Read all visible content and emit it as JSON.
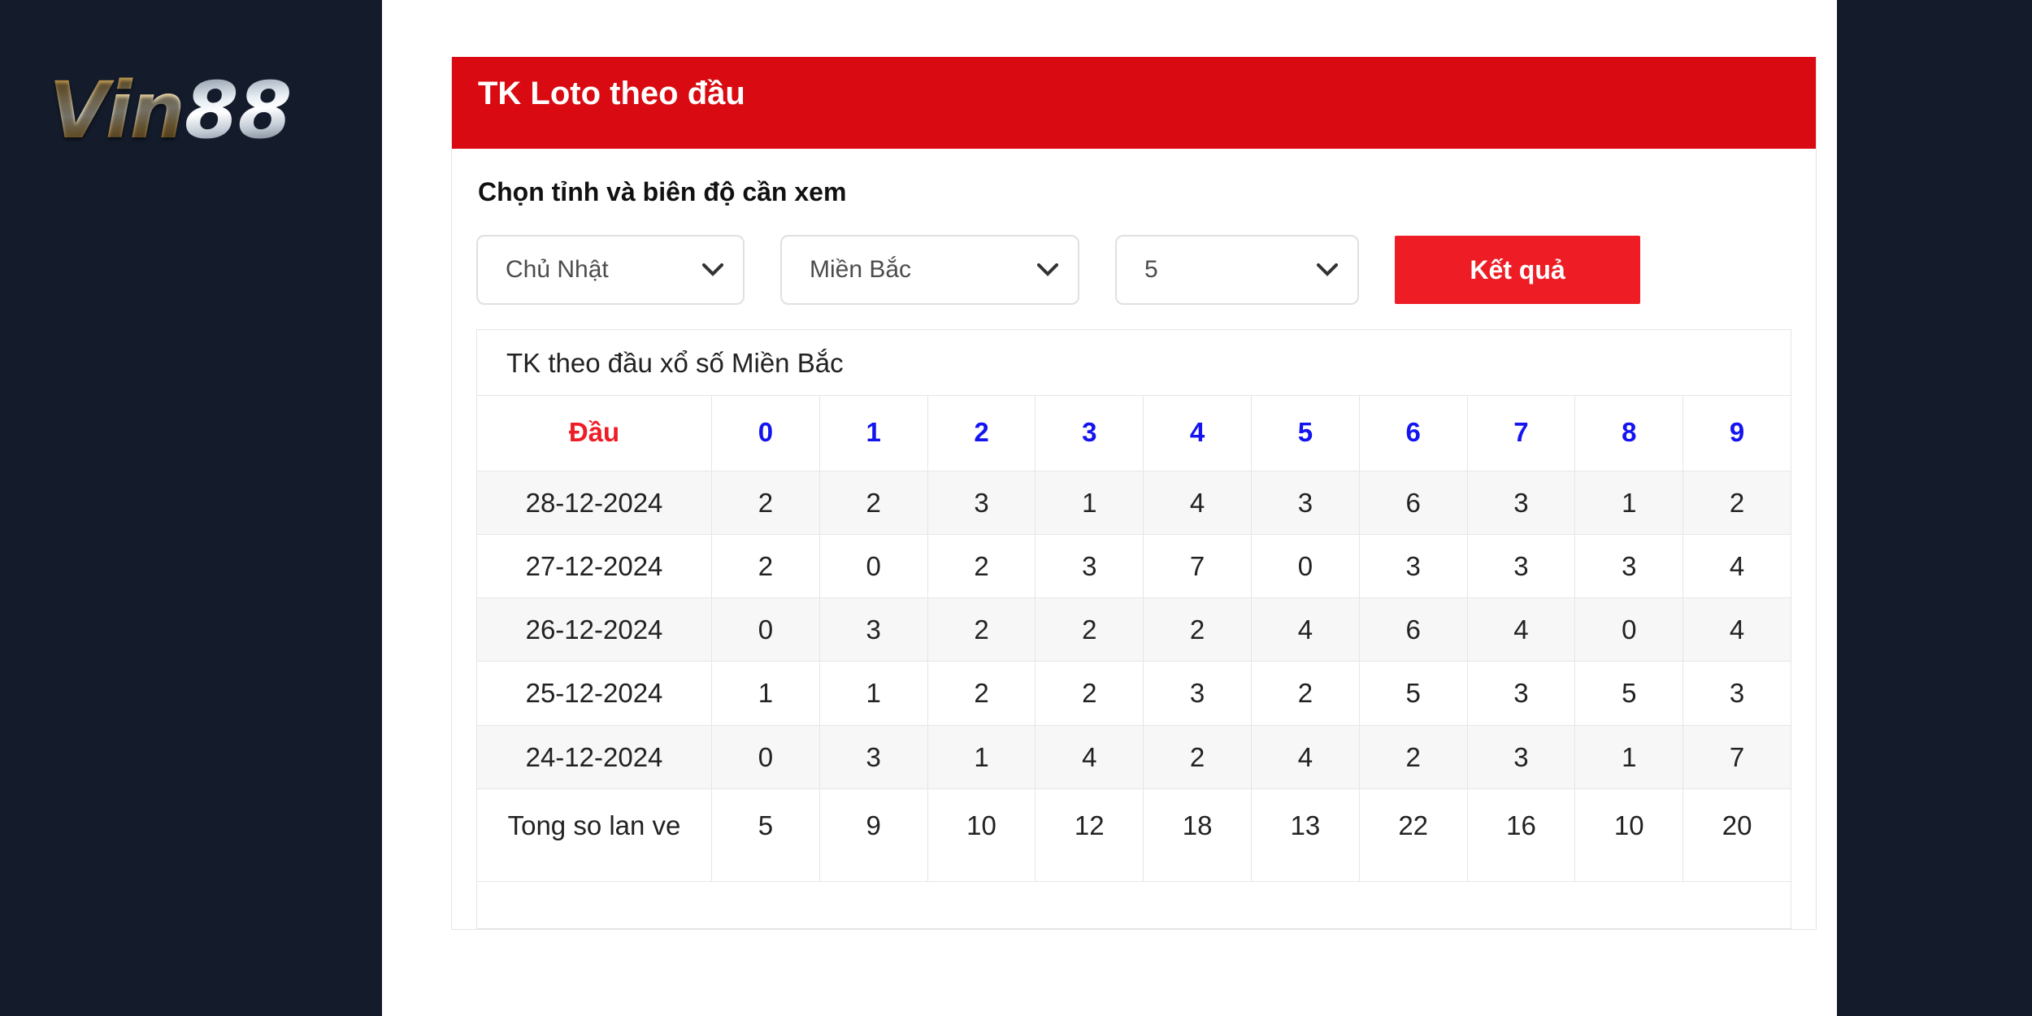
{
  "brand": {
    "name_part1": "Vin",
    "name_part2": "88"
  },
  "panel": {
    "title": "TK Loto theo đầu",
    "form_label": "Chọn tỉnh và biên độ cần xem"
  },
  "controls": {
    "day_select": {
      "value": "Chủ Nhật"
    },
    "region_select": {
      "value": "Miền Bắc"
    },
    "range_select": {
      "value": "5"
    },
    "submit_button": "Kết quả"
  },
  "table": {
    "caption": "TK theo đầu xổ số Miền Bắc",
    "headers": [
      "Đầu",
      "0",
      "1",
      "2",
      "3",
      "4",
      "5",
      "6",
      "7",
      "8",
      "9"
    ],
    "rows": [
      {
        "label": "28-12-2024",
        "values": [
          "2",
          "2",
          "3",
          "1",
          "4",
          "3",
          "6",
          "3",
          "1",
          "2"
        ]
      },
      {
        "label": "27-12-2024",
        "values": [
          "2",
          "0",
          "2",
          "3",
          "7",
          "0",
          "3",
          "3",
          "3",
          "4"
        ]
      },
      {
        "label": "26-12-2024",
        "values": [
          "0",
          "3",
          "2",
          "2",
          "2",
          "4",
          "6",
          "4",
          "0",
          "4"
        ]
      },
      {
        "label": "25-12-2024",
        "values": [
          "1",
          "1",
          "2",
          "2",
          "3",
          "2",
          "5",
          "3",
          "5",
          "3"
        ]
      },
      {
        "label": "24-12-2024",
        "values": [
          "0",
          "3",
          "1",
          "4",
          "2",
          "4",
          "2",
          "3",
          "1",
          "7"
        ]
      }
    ],
    "total_row": {
      "label": "Tong so lan ve",
      "values": [
        "5",
        "9",
        "10",
        "12",
        "18",
        "13",
        "22",
        "16",
        "10",
        "20"
      ]
    }
  },
  "colors": {
    "brand_red": "#d90a12",
    "button_red": "#ee1c25",
    "header_blue": "#1414f0",
    "page_background": "#141c2c"
  }
}
